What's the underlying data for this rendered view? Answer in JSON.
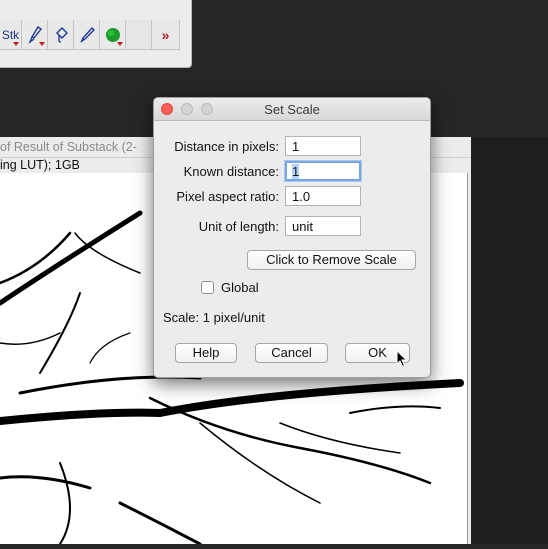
{
  "toolbar": {
    "stack_label": "Stk",
    "more_label": "»",
    "tools": [
      "stacks-menu",
      "brush-tool",
      "flood-fill-tool",
      "pencil-tool",
      "color-picker",
      "blank",
      "more-tools"
    ]
  },
  "image_window": {
    "title": "of Result of Substack (2-",
    "subtitle": "ing LUT); 1GB"
  },
  "dialog": {
    "title": "Set Scale",
    "fields": {
      "distance_label": "Distance in pixels:",
      "distance_value": "1",
      "known_label": "Known distance:",
      "known_value": "1",
      "aspect_label": "Pixel aspect ratio:",
      "aspect_value": "1.0",
      "unit_label": "Unit of length:",
      "unit_value": "unit"
    },
    "remove_scale_label": "Click to Remove Scale",
    "global_label": "Global",
    "global_checked": false,
    "scale_text": "Scale: 1 pixel/unit",
    "buttons": {
      "help": "Help",
      "cancel": "Cancel",
      "ok": "OK"
    }
  }
}
